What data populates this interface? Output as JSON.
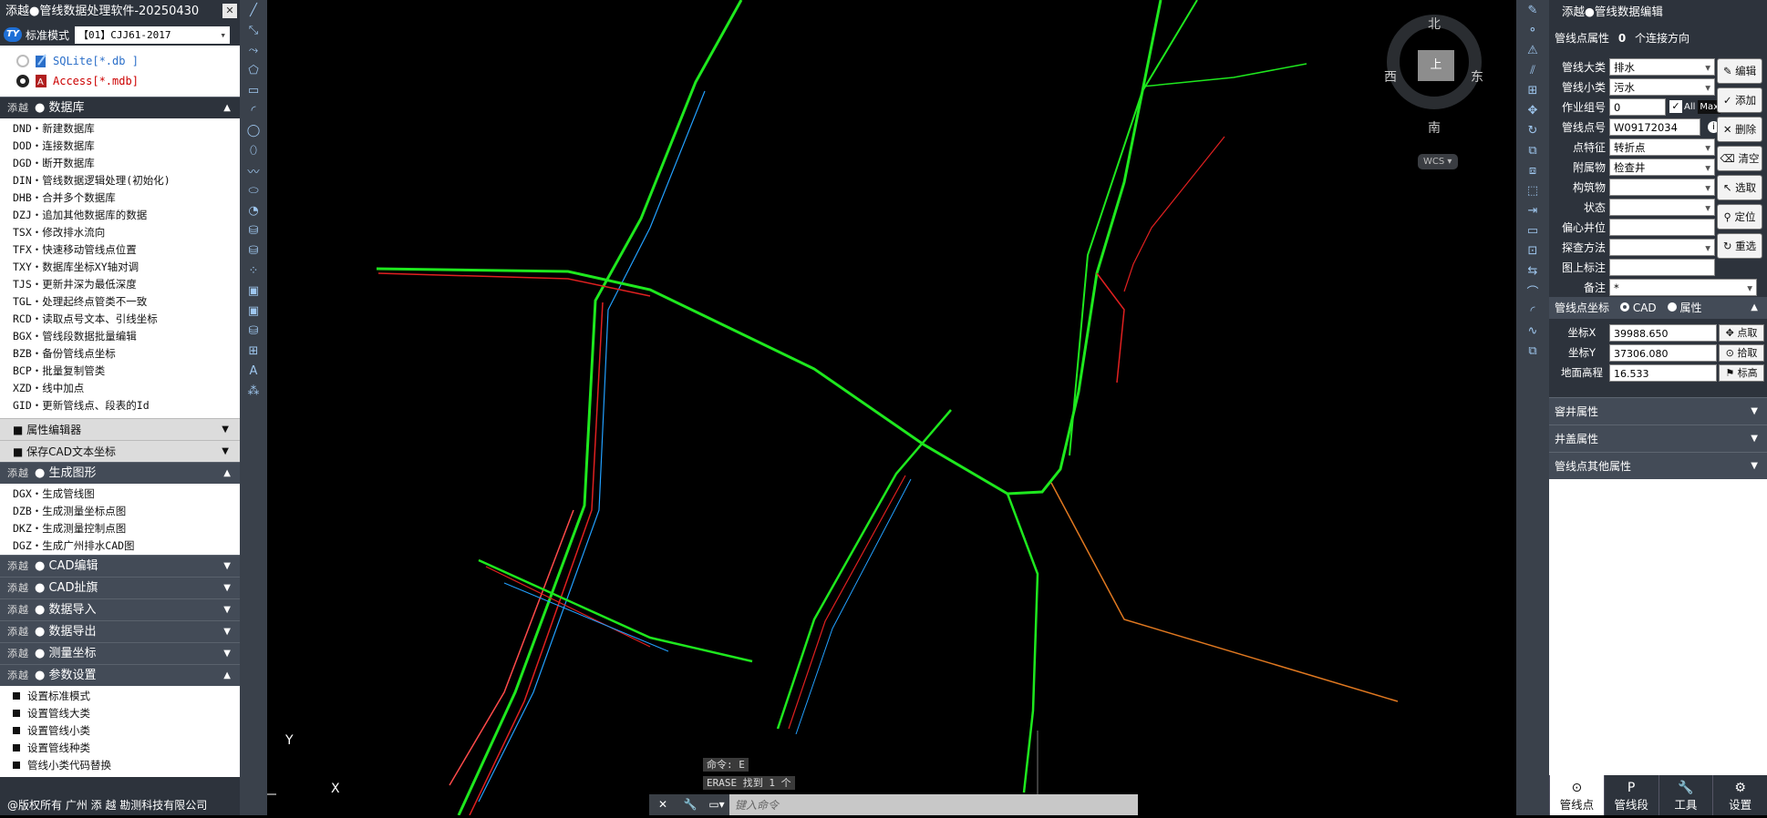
{
  "left": {
    "title": "添越●管线数据处理软件-20250430",
    "mode_label": "标准模式",
    "mode_select": "【01】CJJ61-2017",
    "db_options": [
      {
        "label": "SQLite[*.db ]",
        "selected": false
      },
      {
        "label": "Access[*.mdb]",
        "selected": true
      }
    ],
    "brand": "添越",
    "sec_database": "● 数据库",
    "database_items": [
      "DND・新建数据库",
      "DOD・连接数据库",
      "DGD・断开数据库",
      "DIN・管线数据逻辑处理(初始化)",
      "DHB・合并多个数据库",
      "DZJ・追加其他数据库的数据",
      "TSX・修改排水流向",
      "TFX・快速移动管线点位置",
      "TXY・数据库坐标XY轴对调",
      "TJS・更新井深为最低深度",
      "TGL・处理起终点管类不一致",
      "RCD・读取点号文本、引线坐标",
      "BGX・管线段数据批量编辑",
      "BZB・备份管线点坐标",
      "BCP・批量复制管类",
      "XZD・线中加点",
      "GID・更新管线点、段表的Id"
    ],
    "sub_attr_editor": "■ 属性编辑器",
    "sub_save_cad": "■ 保存CAD文本坐标",
    "sec_generate": "● 生成图形",
    "generate_items": [
      "DGX・生成管线图",
      "DZB・生成测量坐标点图",
      "DKZ・生成测量控制点图",
      "DGZ・生成广州排水CAD图"
    ],
    "sec_cad_edit": "● CAD编辑",
    "sec_cad_flag": "● CAD扯旗",
    "sec_import": "● 数据导入",
    "sec_export": "● 数据导出",
    "sec_survey": "● 测量坐标",
    "sec_params": "● 参数设置",
    "param_items": [
      "设置标准模式",
      "设置管线大类",
      "设置管线小类",
      "设置管线种类",
      "管线小类代码替换"
    ],
    "footer": "@版权所有 广州 添 越 勘测科技有限公司"
  },
  "canvas": {
    "compass": {
      "north": "北",
      "south": "南",
      "east": "东",
      "west": "西",
      "center": "上"
    },
    "wcs": "WCS",
    "axis_y": "Y",
    "axis_x": "X",
    "cmd_line1": "命令: E",
    "cmd_line2": "ERASE 找到 1 个",
    "cmd_placeholder": "键入命令"
  },
  "right": {
    "title": "添越●管线数据编辑",
    "conn_label": "管线点属性",
    "conn_count": "0",
    "conn_suffix": "个连接方向",
    "fields": [
      {
        "label": "管线大类",
        "value": "排水",
        "dropdown": true
      },
      {
        "label": "管线小类",
        "value": "污水",
        "dropdown": true
      },
      {
        "label": "作业组号",
        "value": "0",
        "dropdown": false
      },
      {
        "label": "管线点号",
        "value": "W09172034",
        "dropdown": false
      },
      {
        "label": "点特征",
        "value": "转折点",
        "dropdown": true
      },
      {
        "label": "附属物",
        "value": "检查井",
        "dropdown": true
      },
      {
        "label": "构筑物",
        "value": "",
        "dropdown": true
      },
      {
        "label": "状态",
        "value": "",
        "dropdown": true
      },
      {
        "label": "偏心井位",
        "value": "",
        "dropdown": false
      },
      {
        "label": "探查方法",
        "value": "",
        "dropdown": true
      },
      {
        "label": "图上标注",
        "value": "",
        "dropdown": false
      },
      {
        "label": "备注",
        "value": "*",
        "dropdown": true
      }
    ],
    "all_label": "All",
    "max_label": "Max",
    "buttons": [
      "编辑",
      "添加",
      "删除",
      "清空",
      "选取",
      "定位",
      "重选"
    ],
    "coord_header": "管线点坐标",
    "coord_cad": "CAD",
    "coord_attr": "属性",
    "coords": [
      {
        "label": "坐标X",
        "value": "39988.650",
        "btn": "点取"
      },
      {
        "label": "坐标Y",
        "value": "37306.080",
        "btn": "拾取"
      },
      {
        "label": "地面高程",
        "value": "16.533",
        "btn": "标高"
      }
    ],
    "sections": [
      "窨井属性",
      "井盖属性",
      "管线点其他属性"
    ],
    "tabs": [
      "管线点",
      "管线段",
      "工具",
      "设置"
    ]
  }
}
